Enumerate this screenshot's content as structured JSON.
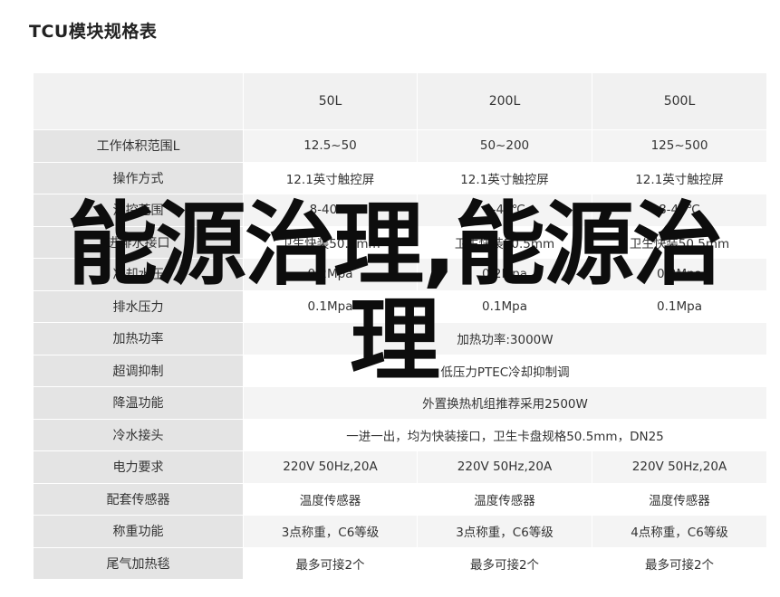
{
  "title": "TCU模块规格表",
  "table": {
    "columns": [
      "",
      "50L",
      "200L",
      "500L"
    ],
    "rows": [
      {
        "label": "工作体积范围L",
        "cells": [
          "12.5~50",
          "50~200",
          "125~500"
        ]
      },
      {
        "label": "操作方式",
        "cells": [
          "12.1英寸触控屏",
          "12.1英寸触控屏",
          "12.1英寸触控屏"
        ]
      },
      {
        "label": "温控范围",
        "cells": [
          "8-40℃",
          "8-40℃",
          "8-40℃"
        ]
      },
      {
        "label": "进排水接口",
        "cells": [
          "卫生快装50.5mm",
          "卫生快装50.5mm",
          "卫生快装50.5mm"
        ]
      },
      {
        "label": "冷却水压",
        "cells": [
          "0.2Mpa",
          "0.2Mpa",
          "0.2Mpa"
        ]
      },
      {
        "label": "排水压力",
        "cells": [
          "0.1Mpa",
          "0.1Mpa",
          "0.1Mpa"
        ]
      },
      {
        "label": "加热功率",
        "span": "加热功率:3000W"
      },
      {
        "label": "超调抑制",
        "span": "低压力PTEC冷却抑制调"
      },
      {
        "label": "降温功能",
        "span": "外置换热机组推荐采用2500W"
      },
      {
        "label": "冷水接头",
        "span": "一进一出，均为快装接口，卫生卡盘规格50.5mm，DN25"
      },
      {
        "label": "电力要求",
        "cells": [
          "220V 50Hz,20A",
          "220V 50Hz,20A",
          "220V 50Hz,20A"
        ]
      },
      {
        "label": "配套传感器",
        "cells": [
          "温度传感器",
          "温度传感器",
          "温度传感器"
        ]
      },
      {
        "label": "称重功能",
        "cells": [
          "3点称重，C6等级",
          "3点称重，C6等级",
          "4点称重，C6等级"
        ]
      },
      {
        "label": "尾气加热毯",
        "cells": [
          "最多可接2个",
          "最多可接2个",
          "最多可接2个"
        ]
      }
    ]
  },
  "overlay_text": "能源治理,能源治理"
}
